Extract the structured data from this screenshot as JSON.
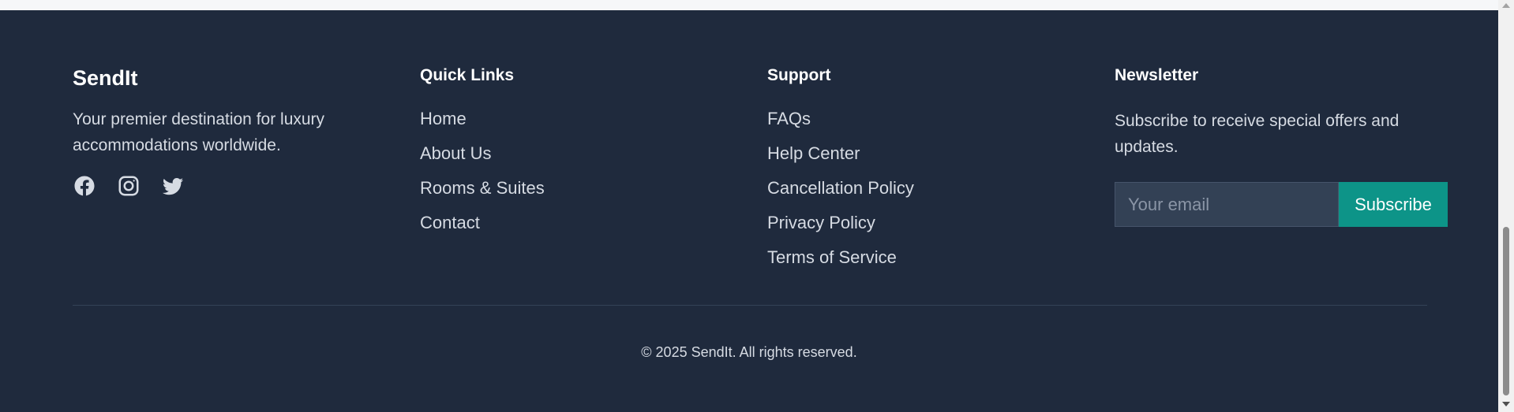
{
  "brand": {
    "name": "SendIt",
    "description": "Your premier destination for luxury accommodations worldwide.",
    "social": [
      {
        "name": "facebook-icon"
      },
      {
        "name": "instagram-icon"
      },
      {
        "name": "twitter-icon"
      }
    ]
  },
  "quick_links": {
    "heading": "Quick Links",
    "items": [
      "Home",
      "About Us",
      "Rooms & Suites",
      "Contact"
    ]
  },
  "support": {
    "heading": "Support",
    "items": [
      "FAQs",
      "Help Center",
      "Cancellation Policy",
      "Privacy Policy",
      "Terms of Service"
    ]
  },
  "newsletter": {
    "heading": "Newsletter",
    "description": "Subscribe to receive special offers and updates.",
    "email_placeholder": "Your email",
    "email_value": "",
    "subscribe_label": "Subscribe"
  },
  "copyright": "© 2025 SendIt. All rights reserved.",
  "colors": {
    "footer_background": "#1f2a3d",
    "accent": "#0d9488",
    "input_background": "#334155"
  }
}
